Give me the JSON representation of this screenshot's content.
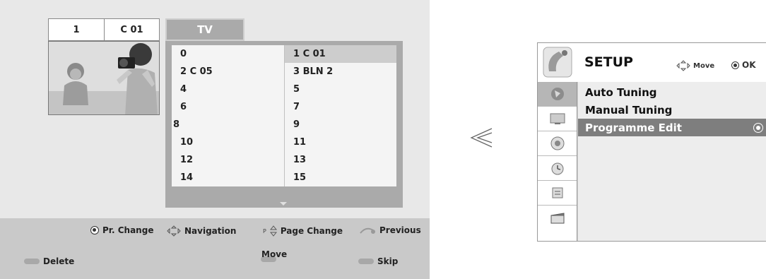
{
  "programme_edit": {
    "current_number": "1",
    "current_name": "C 01",
    "tab_label": "TV",
    "programmes": [
      [
        "0",
        "1 C 01"
      ],
      [
        "2 C 05",
        "3 BLN 2"
      ],
      [
        "4",
        "5"
      ],
      [
        "6",
        "7"
      ],
      [
        "8",
        "9"
      ],
      [
        "10",
        "11"
      ],
      [
        "12",
        "13"
      ],
      [
        "14",
        "15"
      ]
    ],
    "selected_programme": "1 C 01",
    "footer": {
      "pr_change": "Pr. Change",
      "navigation": "Navigation",
      "page_marker": "P",
      "page_change": "Page Change",
      "previous": "Previous",
      "delete": "Delete",
      "move": "Move",
      "skip": "Skip"
    }
  },
  "setup_menu": {
    "title": "SETUP",
    "move_hint": "Move",
    "ok_hint": "OK",
    "items": [
      "Auto Tuning",
      "Manual Tuning",
      "Programme Edit"
    ],
    "selected_item": "Programme Edit",
    "side_icons": [
      "setup-icon",
      "picture-icon",
      "audio-icon",
      "time-icon",
      "option-icon",
      "media-icon"
    ]
  }
}
